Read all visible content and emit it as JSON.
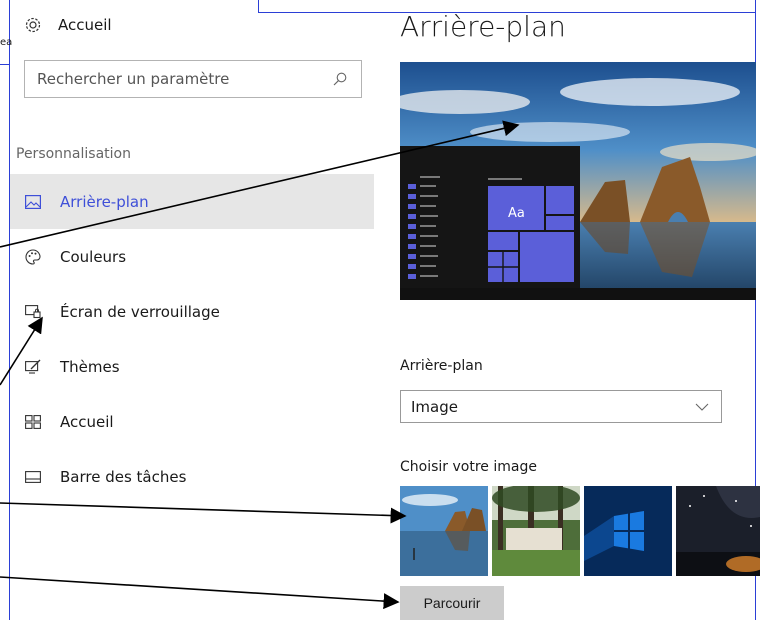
{
  "sidebar": {
    "home_label": "Accueil",
    "cut_fragment": "ea",
    "search_placeholder": "Rechercher un paramètre",
    "section_label": "Personnalisation",
    "items": [
      {
        "label": "Arrière-plan",
        "icon": "picture-icon",
        "active": true
      },
      {
        "label": "Couleurs",
        "icon": "palette-icon",
        "active": false
      },
      {
        "label": "Écran de verrouillage",
        "icon": "lock-screen-icon",
        "active": false
      },
      {
        "label": "Thèmes",
        "icon": "themes-icon",
        "active": false
      },
      {
        "label": "Accueil",
        "icon": "start-icon",
        "active": false
      },
      {
        "label": "Barre des tâches",
        "icon": "taskbar-icon",
        "active": false
      }
    ]
  },
  "main": {
    "title": "Arrière-plan",
    "preview_tile_text": "Aa",
    "background_label": "Arrière-plan",
    "background_value": "Image",
    "choose_label": "Choisir votre image",
    "browse_label": "Parcourir"
  },
  "colors": {
    "accent": "#3e4fd8",
    "tile": "#5b5fd9",
    "active_bg": "#e6e6e6",
    "frame": "#2b3fd6"
  }
}
